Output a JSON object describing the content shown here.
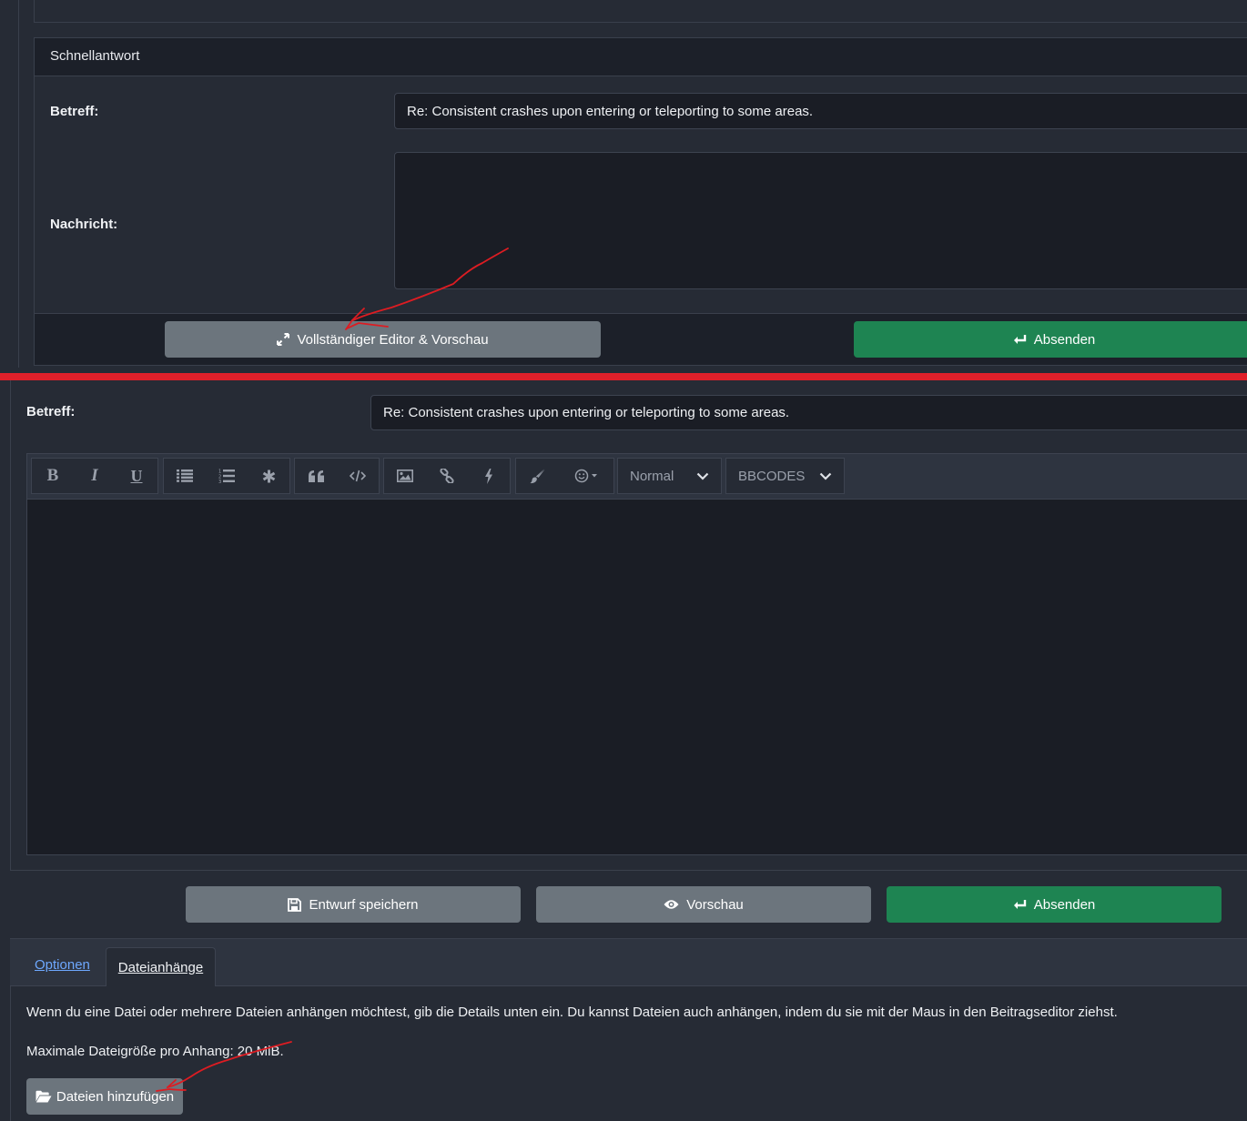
{
  "quick_reply": {
    "header": "Schnellantwort",
    "subject_label": "Betreff:",
    "subject_value": "Re: Consistent crashes upon entering or teleporting to some areas.",
    "message_label": "Nachricht:",
    "full_editor_button": "Vollständiger Editor & Vorschau",
    "submit_button": "Absenden"
  },
  "full_editor": {
    "subject_label": "Betreff:",
    "subject_value": "Re: Consistent crashes upon entering or teleporting to some areas.",
    "toolbar": {
      "bold": "B",
      "italic": "I",
      "underline": "U",
      "font_size_select": "Normal",
      "bbcodes_select": "BBCODES"
    },
    "save_draft_button": "Entwurf speichern",
    "preview_button": "Vorschau",
    "submit_button": "Absenden"
  },
  "tabs": {
    "options": "Optionen",
    "attachments": "Dateianhänge"
  },
  "attachments": {
    "description": "Wenn du eine Datei oder mehrere Dateien anhängen möchtest, gib die Details unten ein. Du kannst Dateien auch anhängen, indem du sie mit der Maus in den Beitragseditor ziehst.",
    "max_size": "Maximale Dateigröße pro Anhang: 20 MiB.",
    "add_files_button": "Dateien hinzufügen"
  },
  "colors": {
    "background": "#262b35",
    "input_bg": "#1a1d25",
    "grey_button": "#6c757d",
    "green_button": "#1e8452",
    "separator_red": "#e0202a",
    "link_blue": "#6ea8fe"
  }
}
